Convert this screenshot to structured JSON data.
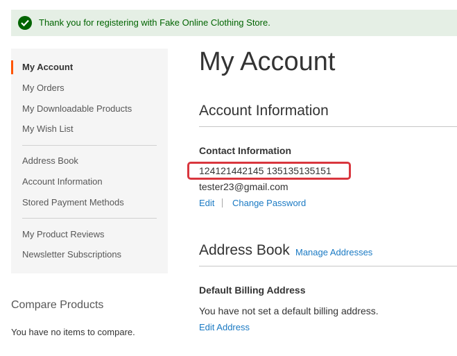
{
  "message": {
    "text": "Thank you for registering with Fake Online Clothing Store.",
    "type": "success",
    "icon": "check-circle-icon"
  },
  "sidebar": {
    "items": [
      {
        "label": "My Account",
        "active": true
      },
      {
        "label": "My Orders"
      },
      {
        "label": "My Downloadable Products"
      },
      {
        "label": "My Wish List"
      },
      {
        "label": "Address Book"
      },
      {
        "label": "Account Information"
      },
      {
        "label": "Stored Payment Methods"
      },
      {
        "label": "My Product Reviews"
      },
      {
        "label": "Newsletter Subscriptions"
      }
    ]
  },
  "compare": {
    "title": "Compare Products",
    "empty_text": "You have no items to compare."
  },
  "main": {
    "title": "My Account",
    "account_info": {
      "title": "Account Information",
      "contact_title": "Contact Information",
      "name": "124121442145 135135135151",
      "email": "tester23@gmail.com",
      "edit_label": "Edit",
      "change_password_label": "Change Password"
    },
    "address_book": {
      "title": "Address Book",
      "manage_label": "Manage Addresses",
      "billing_title": "Default Billing Address",
      "billing_text": "You have not set a default billing address.",
      "edit_address_label": "Edit Address"
    }
  },
  "colors": {
    "success_bg": "#e5efe5",
    "success_text": "#006400",
    "link": "#1979c3",
    "active_nav_bar": "#ff5501",
    "annotation_box": "#d9363e"
  }
}
